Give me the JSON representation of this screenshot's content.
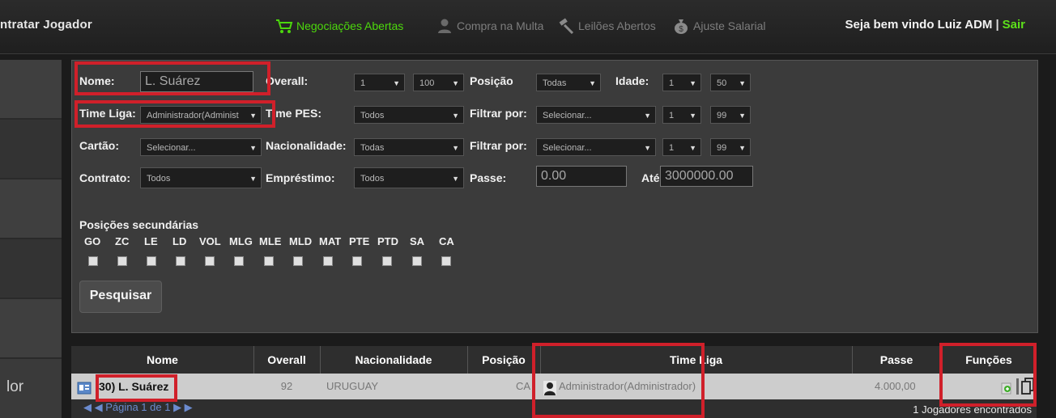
{
  "header": {
    "title": "ntratar Jogador",
    "nav": [
      {
        "label": "Negociações Abertas",
        "icon": "cart-icon",
        "active": true
      },
      {
        "label": "Compra na Multa",
        "icon": "person-icon",
        "active": false
      },
      {
        "label": "Leilões Abertos",
        "icon": "gavel-icon",
        "active": false
      },
      {
        "label": "Ajuste Salarial",
        "icon": "money-bag-icon",
        "active": false
      }
    ],
    "welcome": "Seja bem vindo Luiz ADM",
    "separator": "|",
    "logout": "Sair"
  },
  "sidebar": {
    "partial_label": "lor"
  },
  "filters": {
    "nome_label": "Nome:",
    "nome_value": "L. Suárez",
    "overall_label": "Overall:",
    "overall_min": "1",
    "overall_max": "100",
    "posicao_label": "Posição",
    "posicao_value": "Todas",
    "idade_label": "Idade:",
    "idade_min": "1",
    "idade_max": "50",
    "time_liga_label": "Time Liga:",
    "time_liga_value": "Administrador(Administ",
    "time_pes_label": "Time PES:",
    "time_pes_value": "Todos",
    "filtrar1_label": "Filtrar por:",
    "filtrar1_value": "Selecionar...",
    "filtrar1_min": "1",
    "filtrar1_max": "99",
    "cartao_label": "Cartão:",
    "cartao_value": "Selecionar...",
    "nacionalidade_label": "Nacionalidade:",
    "nacionalidade_value": "Todas",
    "filtrar2_label": "Filtrar por:",
    "filtrar2_value": "Selecionar...",
    "filtrar2_min": "1",
    "filtrar2_max": "99",
    "contrato_label": "Contrato:",
    "contrato_value": "Todos",
    "emprestimo_label": "Empréstimo:",
    "emprestimo_value": "Todos",
    "passe_label": "Passe:",
    "passe_min": "0.00",
    "ate_label": "Até",
    "passe_max": "3000000.00",
    "secondary_title": "Posições secundárias",
    "secondary_positions": [
      "GO",
      "ZC",
      "LE",
      "LD",
      "VOL",
      "MLG",
      "MLE",
      "MLD",
      "MAT",
      "PTE",
      "PTD",
      "SA",
      "CA"
    ],
    "search_button": "Pesquisar"
  },
  "results": {
    "columns": [
      "Nome",
      "Overall",
      "Nacionalidade",
      "Posição",
      "Time Liga",
      "Passe",
      "Funções"
    ],
    "row": {
      "nome": "30) L. Suárez",
      "overall": "92",
      "nacionalidade": "URUGUAY",
      "posicao": "CA",
      "time_liga": "Administrador(Administrador)",
      "passe": "4.000,00"
    },
    "pager": "◀ ◀ Página 1 de 1 ▶ ▶",
    "footer_count": "1 Jogadores encontrados"
  },
  "colors": {
    "accent_green": "#4cd80c",
    "highlight_red": "#d0202a"
  }
}
